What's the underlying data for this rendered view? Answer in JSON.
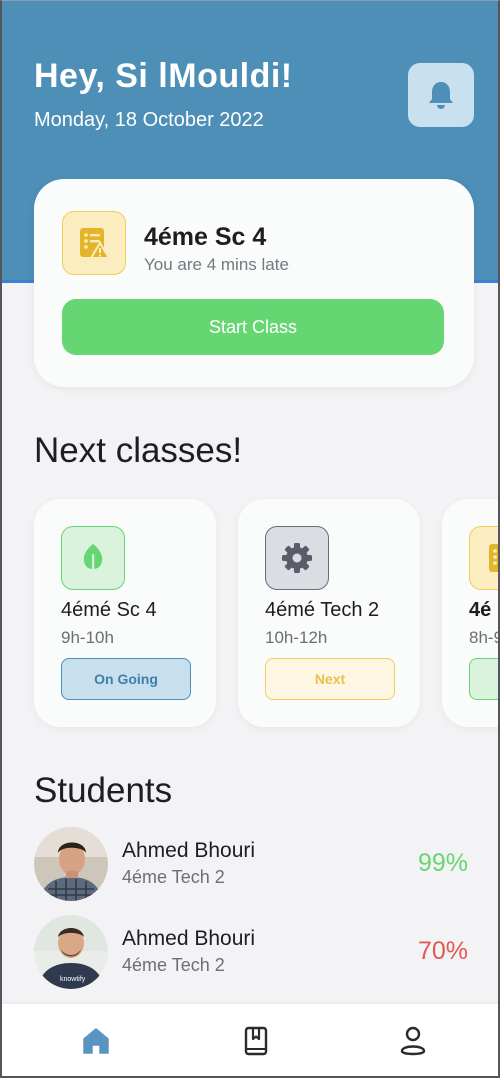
{
  "header": {
    "greeting": "Hey, Si lMouldi!",
    "date": "Monday, 18 October 2022",
    "notification_icon": "bell-icon"
  },
  "current_class": {
    "icon": "checklist-warning-icon",
    "title": "4éme Sc 4",
    "status": "You are 4 mins late",
    "start_button": "Start Class",
    "colors": {
      "icon_bg": "#fbedc0",
      "icon_border": "#f1cf55",
      "button": "#66d672"
    }
  },
  "next_classes": {
    "title": "Next classes!",
    "items": [
      {
        "icon": "leaf-icon",
        "name": "4émé Sc 4",
        "time": "9h-10h",
        "badge": "On Going"
      },
      {
        "icon": "gear-icon",
        "name": "4émé Tech 2",
        "time": "10h-12h",
        "badge": "Next"
      },
      {
        "icon": "checklist-icon",
        "name": "4é",
        "time": "8h-9",
        "badge": ""
      }
    ]
  },
  "students": {
    "title": "Students",
    "items": [
      {
        "name": "Ahmed Bhouri",
        "class": "4éme Tech 2",
        "score": "99%"
      },
      {
        "name": "Ahmed Bhouri",
        "class": "4éme Tech 2",
        "score": "70%"
      }
    ]
  },
  "bottom_nav": {
    "items": [
      "home-icon",
      "book-icon",
      "profile-icon"
    ],
    "active": "home-icon"
  },
  "colors": {
    "header": "#4e8fb7",
    "green": "#66d672",
    "score_high": "#66d672",
    "score_low": "#e05a50"
  }
}
